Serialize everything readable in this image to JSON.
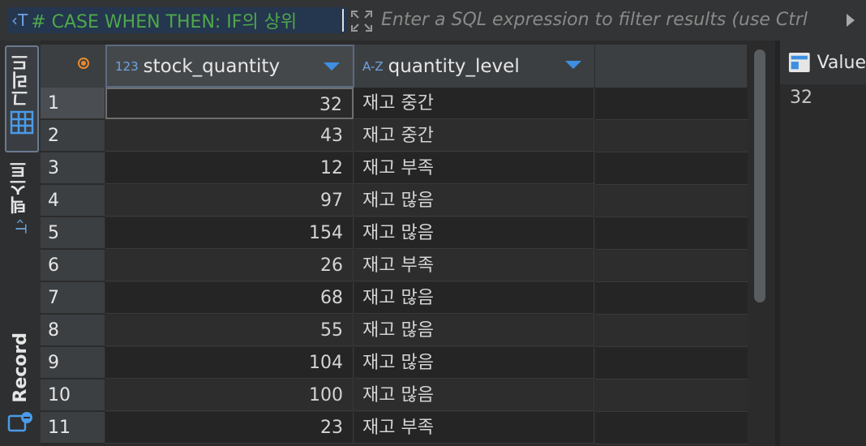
{
  "filter": {
    "query_text": "# CASE WHEN THEN: IF의 상위",
    "placeholder": "Enter a SQL expression to filter results (use Ctrl"
  },
  "side_tabs": {
    "grid_label": "그리드",
    "text_label": "텍스트",
    "record_label": "Record"
  },
  "columns": [
    {
      "type": "123",
      "name": "stock_quantity"
    },
    {
      "type": "A-Z",
      "name": "quantity_level"
    }
  ],
  "rows": [
    {
      "num": "1",
      "stock_quantity": "32",
      "quantity_level": "재고 중간"
    },
    {
      "num": "2",
      "stock_quantity": "43",
      "quantity_level": "재고 중간"
    },
    {
      "num": "3",
      "stock_quantity": "12",
      "quantity_level": "재고 부족"
    },
    {
      "num": "4",
      "stock_quantity": "97",
      "quantity_level": "재고 많음"
    },
    {
      "num": "5",
      "stock_quantity": "154",
      "quantity_level": "재고 많음"
    },
    {
      "num": "6",
      "stock_quantity": "26",
      "quantity_level": "재고 부족"
    },
    {
      "num": "7",
      "stock_quantity": "68",
      "quantity_level": "재고 많음"
    },
    {
      "num": "8",
      "stock_quantity": "55",
      "quantity_level": "재고 많음"
    },
    {
      "num": "9",
      "stock_quantity": "104",
      "quantity_level": "재고 많음"
    },
    {
      "num": "10",
      "stock_quantity": "100",
      "quantity_level": "재고 많음"
    },
    {
      "num": "11",
      "stock_quantity": "23",
      "quantity_level": "재고 부족"
    }
  ],
  "value_panel": {
    "title": "Value",
    "value": "32"
  },
  "colors": {
    "accent_blue": "#3d8fe0",
    "query_green": "#4ea84a",
    "selection_orange": "#e88a2c"
  }
}
